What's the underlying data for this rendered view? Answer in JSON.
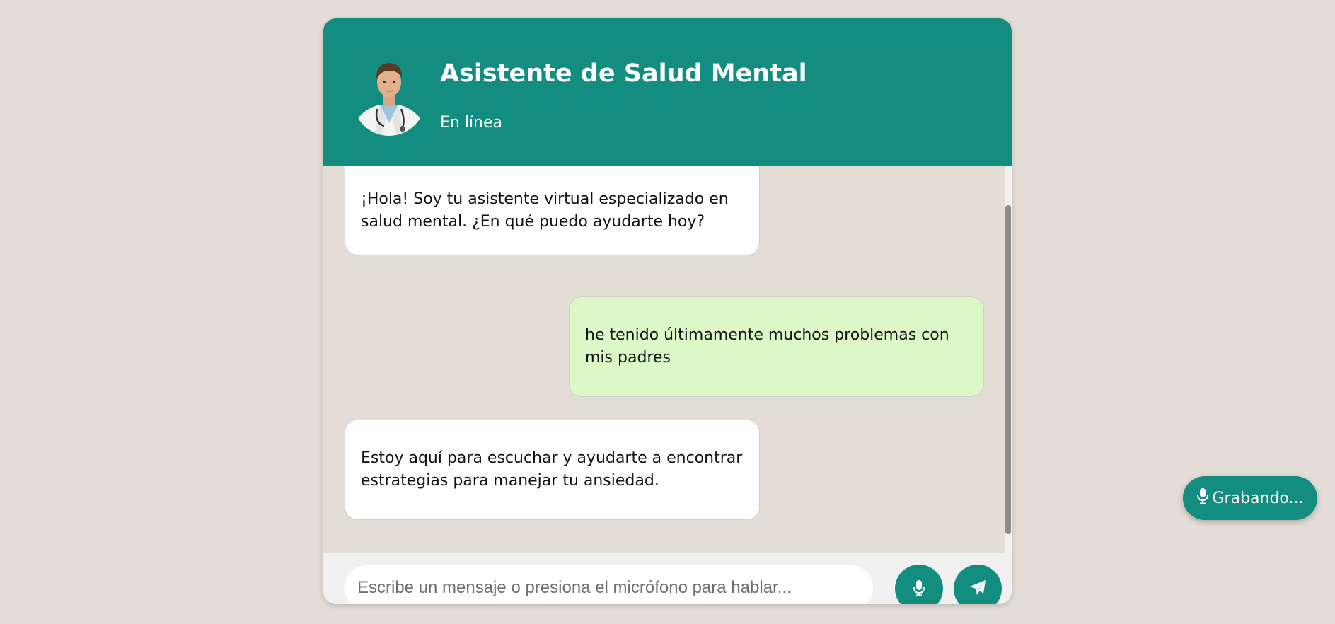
{
  "header": {
    "title": "Asistente de Salud Mental",
    "status": "En línea",
    "avatar_icon": "doctor-avatar"
  },
  "messages": [
    {
      "sender": "bot",
      "text": "¡Hola! Soy tu asistente virtual especializado en salud mental. ¿En qué puedo ayudarte hoy?"
    },
    {
      "sender": "user",
      "text": "he tenido últimamente muchos problemas con mis padres"
    },
    {
      "sender": "bot",
      "text": "Estoy aquí para escuchar y ayudarte a encontrar estrategias para manejar tu ansiedad."
    }
  ],
  "input": {
    "placeholder": "Escribe un mensaje o presiona el micrófono para hablar...",
    "value": ""
  },
  "buttons": {
    "mic_icon": "microphone-icon",
    "send_icon": "paper-plane-icon"
  },
  "recording": {
    "label": "Grabando...",
    "icon": "microphone-icon"
  },
  "colors": {
    "accent": "#138d80",
    "background": "#e4dcd6",
    "bot_bubble": "#ffffff",
    "user_bubble": "#dcf8c6"
  }
}
